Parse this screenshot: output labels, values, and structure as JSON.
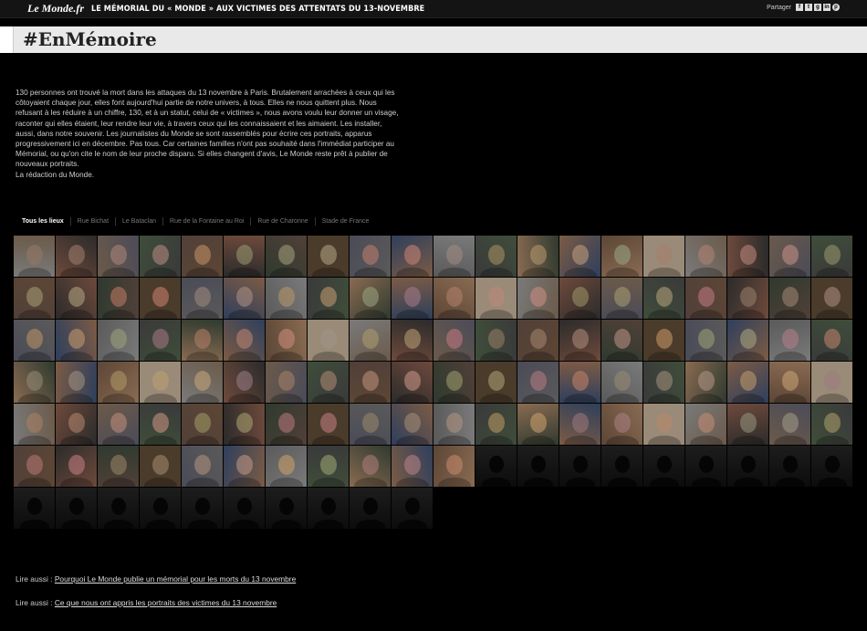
{
  "header": {
    "logo": "Le Monde.fr",
    "title": "LE MÉMORIAL DU « MONDE » AUX VICTIMES DES ATTENTATS DU 13-NOVEMBRE",
    "share_label": "Partager",
    "share_icons": [
      {
        "name": "facebook-icon",
        "glyph": "f"
      },
      {
        "name": "twitter-icon",
        "glyph": "t"
      },
      {
        "name": "googleplus-icon",
        "glyph": "g"
      },
      {
        "name": "linkedin-icon",
        "glyph": "in"
      },
      {
        "name": "pinterest-icon",
        "glyph": "p"
      }
    ]
  },
  "hashtag": "#EnMémoire",
  "intro": {
    "paragraph": "130 personnes ont trouvé la mort dans les attaques du 13 novembre à Paris. Brutalement arrachées à ceux qui les côtoyaient chaque jour, elles font aujourd'hui partie de notre univers, à tous. Elles ne nous quittent plus. Nous refusant à les réduire à un chiffre, 130, et à un statut, celui de « victimes », nous avons voulu leur donner un visage, raconter qui elles étaient, leur rendre leur vie, à travers ceux qui les connaissaient et les aimaient. Les installer, aussi, dans notre souvenir. Les journalistes du Monde se sont rassemblés pour écrire ces portraits, apparus progressivement ici en décembre. Pas tous. Car certaines familles n'ont pas souhaité dans l'immédiat participer au Mémorial, ou qu'on cite le nom de leur proche disparu. Si elles changent d'avis, Le Monde reste prêt à publier de nouveaux portraits.",
    "signature": "La rédaction du Monde."
  },
  "filters": [
    {
      "label": "Tous les lieux",
      "active": true
    },
    {
      "label": "Rue Bichat",
      "active": false
    },
    {
      "label": "Le Bataclan",
      "active": false
    },
    {
      "label": "Rue de la Fontaine au Roi",
      "active": false
    },
    {
      "label": "Rue de Charonne",
      "active": false
    },
    {
      "label": "Stade de France",
      "active": false
    }
  ],
  "portraits": {
    "photo_count": 111,
    "placeholder_count": 19,
    "palette": [
      "#3a3a3a",
      "#6b5a4a",
      "#2e3f5c",
      "#7a7a7a",
      "#4a3b2a",
      "#5c4636",
      "#2b2b2b",
      "#8a6b52",
      "#3f4d3a",
      "#5a5a5a",
      "#6e4a3c",
      "#4b4b58",
      "#9a8a78",
      "#2f3a2f",
      "#7c5b45",
      "#514038"
    ]
  },
  "lire_aussi": [
    {
      "prefix": "Lire aussi : ",
      "link": "Pourquoi Le Monde publie un mémorial pour les morts du 13 novembre"
    },
    {
      "prefix": "Lire aussi : ",
      "link": "Ce que nous ont appris les portraits des victimes du 13 novembre"
    }
  ]
}
